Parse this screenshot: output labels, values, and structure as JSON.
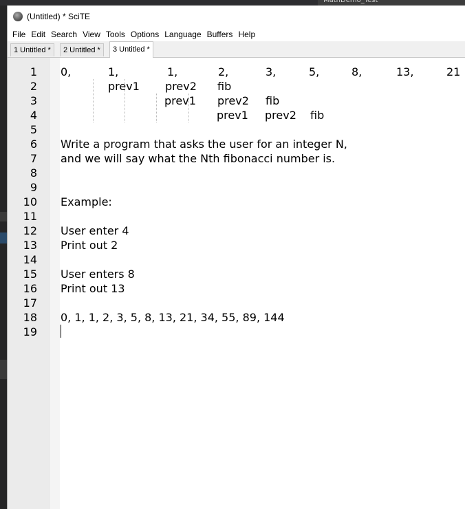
{
  "background": {
    "tab_label": "MathDemo_Test"
  },
  "window": {
    "title": "(Untitled) * SciTE"
  },
  "menu": [
    "File",
    "Edit",
    "Search",
    "View",
    "Tools",
    "Options",
    "Language",
    "Buffers",
    "Help"
  ],
  "tabs": [
    {
      "label": "1 Untitled *",
      "active": false
    },
    {
      "label": "2 Untitled *",
      "active": false
    },
    {
      "label": "3 Untitled *",
      "active": true
    }
  ],
  "line_numbers": [
    "1",
    "2",
    "3",
    "4",
    "5",
    "6",
    "7",
    "8",
    "9",
    "10",
    "11",
    "12",
    "13",
    "14",
    "15",
    "16",
    "17",
    "18",
    "19"
  ],
  "lines": {
    "l1": [
      "0,",
      "1,",
      "1,",
      "2,",
      "3,",
      "5,",
      "8,",
      "13,",
      "21"
    ],
    "l2": [
      "prev1",
      "prev2",
      "fib"
    ],
    "l3": [
      "prev1",
      "prev2",
      "fib"
    ],
    "l4": [
      "prev1",
      "prev2",
      "fib"
    ],
    "l6": "Write a program that asks the user for an integer N,",
    "l7": "and we will say what the Nth fibonacci number is.",
    "l10": "Example:",
    "l12": "User enter 4",
    "l13": "Print out 2",
    "l15": "User enters 8",
    "l16": "Print out 13",
    "l18": "0, 1, 1, 2, 3, 5, 8, 13, 21, 34, 55, 89, 144"
  },
  "colors": {
    "margin": "#ebebeb",
    "editor_bg": "#ffffff",
    "text": "#000000"
  }
}
